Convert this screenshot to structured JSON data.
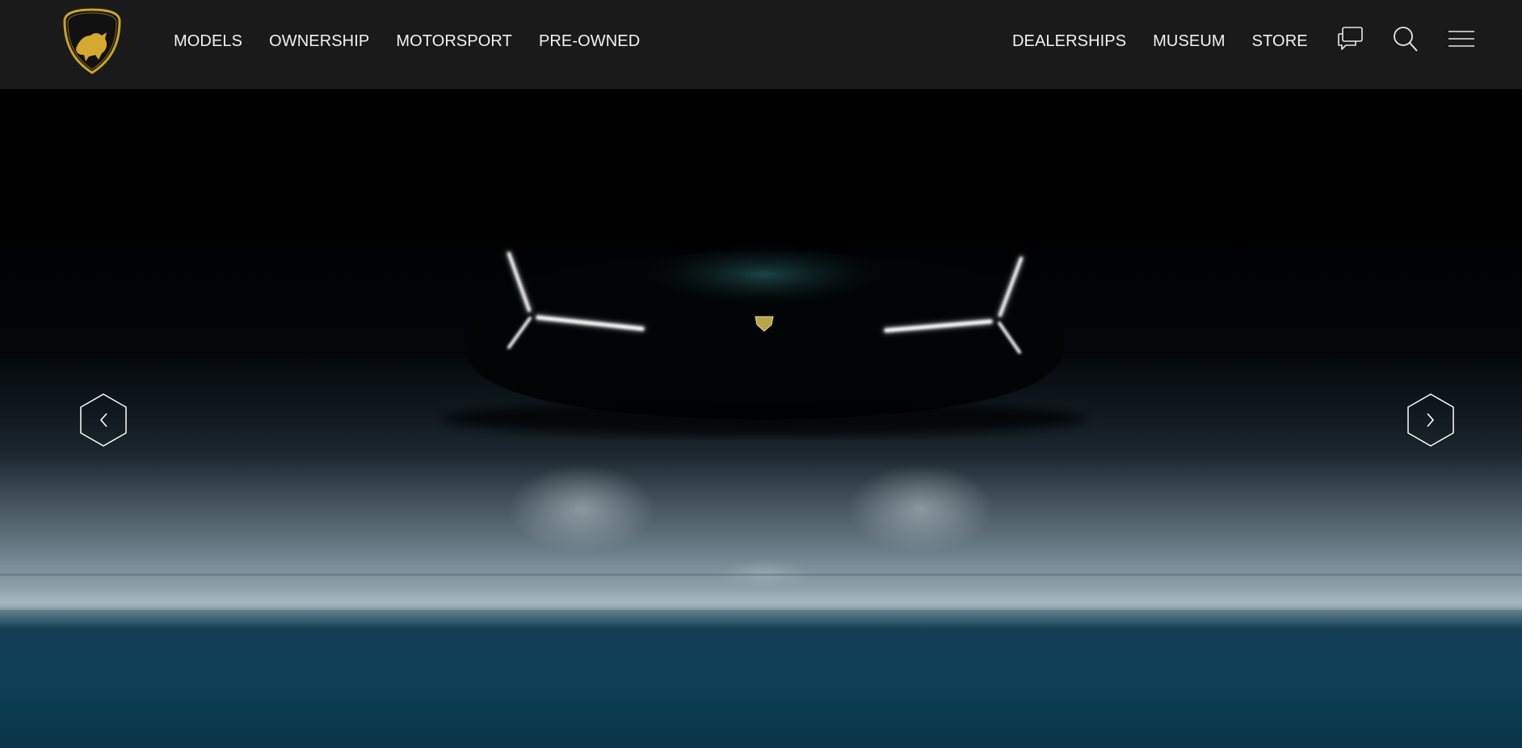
{
  "brand": {
    "logo_text": "LAMBORGHINI"
  },
  "nav": {
    "left": [
      "MODELS",
      "OWNERSHIP",
      "MOTORSPORT",
      "PRE-OWNED"
    ],
    "right": [
      "DEALERSHIPS",
      "MUSEUM",
      "STORE"
    ]
  },
  "icons": {
    "chat": "chat-icon",
    "search": "search-icon",
    "menu": "hamburger-menu-icon",
    "prev": "chevron-left-icon",
    "next": "chevron-right-icon"
  },
  "colors": {
    "header_bg": "#1a1a1a",
    "nav_text": "#f2f2f2",
    "logo_gold": "#c9a227"
  }
}
